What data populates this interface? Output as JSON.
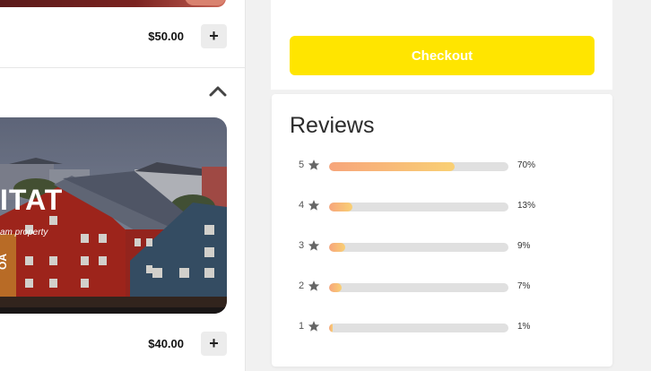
{
  "cart": {
    "items": [
      {
        "price": "$50.00",
        "add_label": "+"
      },
      {
        "price": "$40.00",
        "add_label": "+"
      }
    ],
    "hero": {
      "title": "ITAT",
      "subtitle": "am property",
      "side_text": "OA"
    }
  },
  "checkout": {
    "label": "Checkout",
    "color": "#ffe500"
  },
  "reviews": {
    "title": "Reviews",
    "rows": [
      {
        "stars": "5",
        "percent_label": "70%",
        "fraction": 0.7
      },
      {
        "stars": "4",
        "percent_label": "13%",
        "fraction": 0.13
      },
      {
        "stars": "3",
        "percent_label": "9%",
        "fraction": 0.09
      },
      {
        "stars": "2",
        "percent_label": "7%",
        "fraction": 0.07
      },
      {
        "stars": "1",
        "percent_label": "1%",
        "fraction": 0.01
      }
    ],
    "star_icon": "star-icon"
  }
}
